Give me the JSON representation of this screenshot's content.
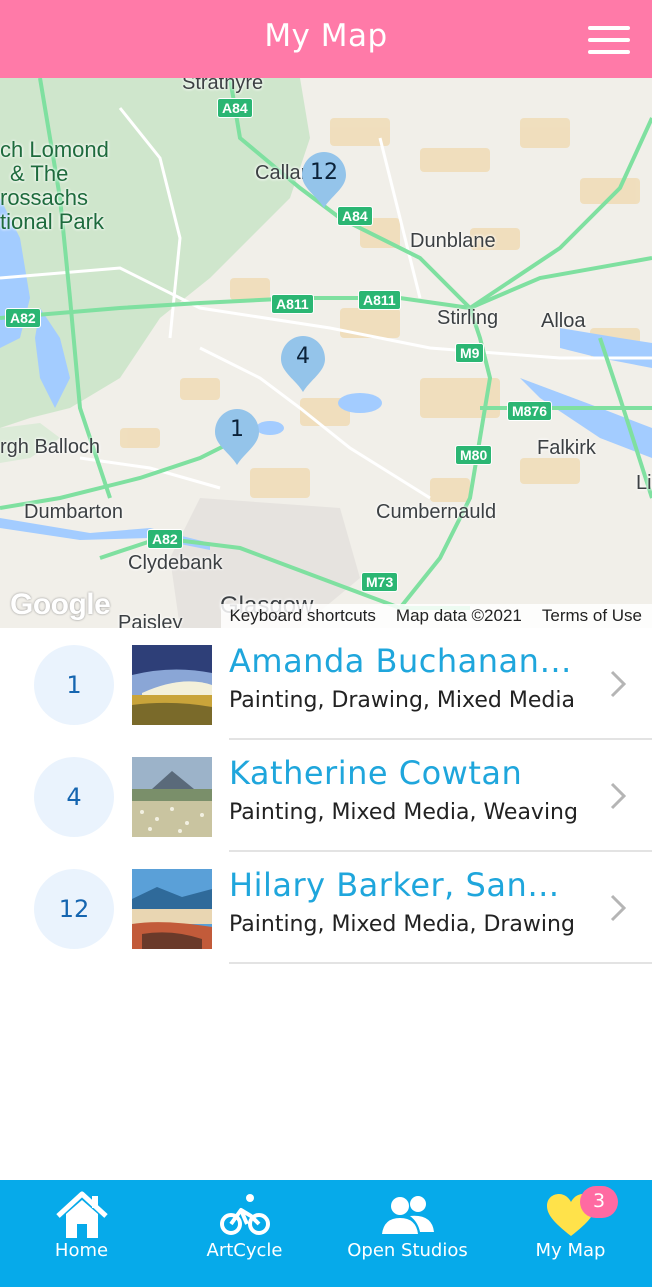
{
  "header": {
    "title": "My Map"
  },
  "map": {
    "places": [
      "Strathyre",
      "Callander",
      "Dunblane",
      "Stirling",
      "Alloa",
      "Falkirk",
      "Li",
      "rgh Balloch",
      "Dumbarton",
      "Clydebank",
      "Cumbernauld",
      "Glasgow",
      "Paisley"
    ],
    "park_lines": [
      "ch Lomond",
      "& The",
      "rossachs",
      "tional Park"
    ],
    "roads": [
      "A84",
      "A84",
      "A811",
      "A811",
      "A82",
      "M9",
      "M876",
      "M80",
      "A82",
      "M73"
    ],
    "markers": [
      "12",
      "4",
      "1"
    ],
    "google_logo": "Google",
    "attribution": {
      "shortcuts": "Keyboard shortcuts",
      "data": "Map data ©2021",
      "terms": "Terms of Use"
    },
    "colors": {
      "park": "#cfe6cc",
      "water": "#a3ccff",
      "motorway": "#7fe0a0",
      "marker": "#94c4ea"
    }
  },
  "list": [
    {
      "number": "1",
      "name": "Amanda Buchanan H...",
      "categories": "Painting, Drawing, Mixed Media"
    },
    {
      "number": "4",
      "name": "Katherine Cowtan",
      "categories": "Painting, Mixed Media, Weaving"
    },
    {
      "number": "12",
      "name": "Hilary Barker, Sandra...",
      "categories": "Painting, Mixed Media, Drawing"
    }
  ],
  "nav": {
    "items": [
      {
        "label": "Home",
        "icon": "home-icon"
      },
      {
        "label": "ArtCycle",
        "icon": "bicycle-icon"
      },
      {
        "label": "Open Studios",
        "icon": "people-icon"
      },
      {
        "label": "My Map",
        "icon": "heart-icon"
      }
    ],
    "my_map_count": "3",
    "colors": {
      "nav_bg": "#06aaea",
      "header_bg": "#ff7aa8",
      "heart": "#ffe24a",
      "count_bg": "#ff6aa2"
    }
  }
}
